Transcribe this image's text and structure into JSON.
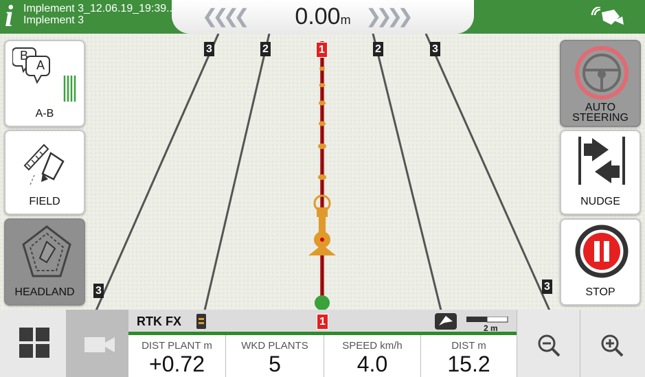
{
  "top": {
    "implement_title": "Implement 3_12.06.19_19:39...",
    "implement_name": "Implement 3",
    "deviation_value": "0.00",
    "deviation_unit": "m",
    "chevrons_left": "❮❮❮❮",
    "chevrons_right": "❯❯❯❯"
  },
  "left_buttons": [
    {
      "label": "A-B",
      "badge_b": "B",
      "badge_a": "A"
    },
    {
      "label": "FIELD"
    },
    {
      "label": "HEADLAND"
    }
  ],
  "right_buttons": [
    {
      "label_line1": "AUTO",
      "label_line2": "STEERING"
    },
    {
      "label": "NUDGE"
    },
    {
      "label": "STOP"
    }
  ],
  "line_badges": {
    "center": "1",
    "near_left": "2",
    "near_right": "2",
    "far_left": "3",
    "far_right": "3",
    "bottom_left": "3",
    "bottom_right": "3",
    "bottom_center": "1"
  },
  "status": {
    "gps_fix": "RTK FX",
    "scale_label": "2 m"
  },
  "metrics": [
    {
      "header": "DIST PLANT m",
      "value": "+0.72"
    },
    {
      "header": "WKD PLANTS",
      "value": "5"
    },
    {
      "header": "SPEED km/h",
      "value": "4.0"
    },
    {
      "header": "DIST m",
      "value": "15.2"
    }
  ],
  "colors": {
    "bar_green": "#3f8f3d",
    "guidance_red": "#e5201f",
    "vehicle_orange": "#f0a020"
  }
}
